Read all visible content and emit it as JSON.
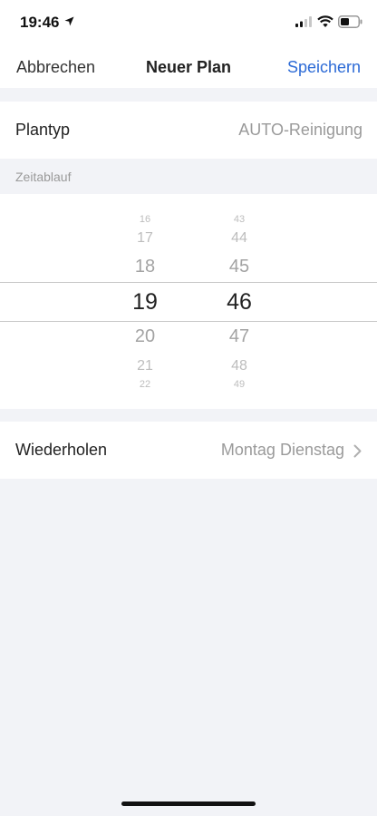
{
  "status_bar": {
    "time": "19:46"
  },
  "nav": {
    "cancel": "Abbrechen",
    "title": "Neuer Plan",
    "save": "Speichern"
  },
  "plan_type": {
    "label": "Plantyp",
    "value": "AUTO-Reinigung"
  },
  "schedule_section": {
    "title": "Zeitablauf"
  },
  "time_picker": {
    "hours": [
      "16",
      "17",
      "18",
      "19",
      "20",
      "21",
      "22"
    ],
    "minutes": [
      "43",
      "44",
      "45",
      "46",
      "47",
      "48",
      "49"
    ],
    "selected_hour": "19",
    "selected_minute": "46"
  },
  "repeat": {
    "label": "Wiederholen",
    "value": "Montag Dienstag"
  },
  "colors": {
    "accent": "#2d6bd6",
    "background": "#f2f3f7"
  }
}
